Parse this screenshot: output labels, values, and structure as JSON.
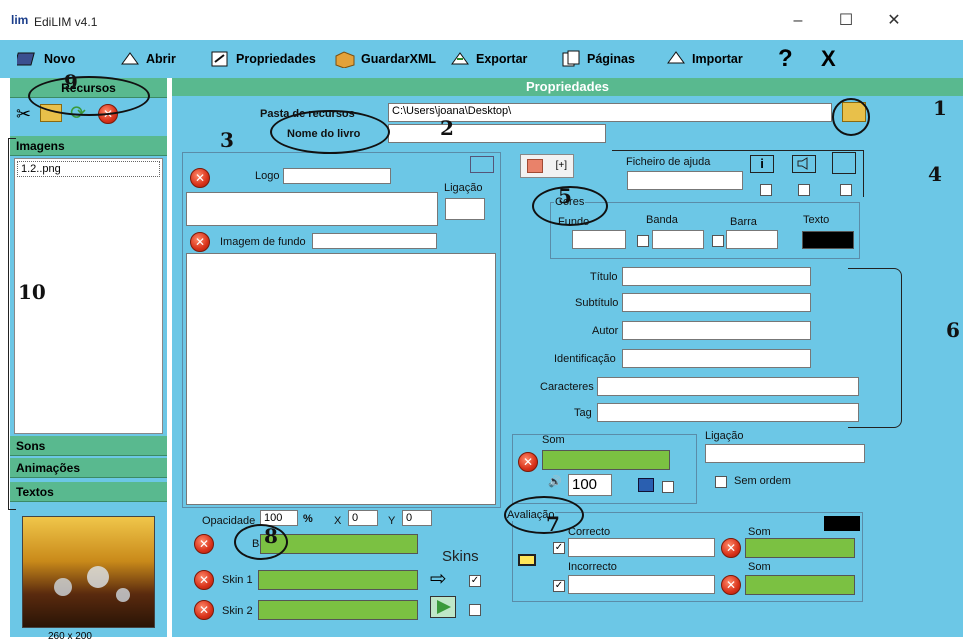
{
  "window": {
    "app_name": "EdiLIM v4.1",
    "logo_text": "lim",
    "minimize": "–",
    "maximize": "☐",
    "close": "✕"
  },
  "menu": {
    "novo": "Novo",
    "abrir": "Abrir",
    "propriedades": "Propriedades",
    "guardar": "GuardarXML",
    "exportar": "Exportar",
    "paginas": "Páginas",
    "importar": "Importar",
    "help": "?",
    "exit": "X"
  },
  "sidebar": {
    "title": "Recursos",
    "imagens": "Imagens",
    "files": [
      "1.2..png"
    ],
    "sons": "Sons",
    "animacoes": "Animações",
    "textos": "Textos",
    "preview_size": "260 x 200"
  },
  "main": {
    "header": "Propriedades",
    "pasta_label": "Pasta de recursos",
    "pasta_value": "C:\\Users\\joana\\Desktop\\",
    "nome_label": "Nome do livro",
    "nome_value": "",
    "logo_label": "Logo",
    "ligacao_label": "Ligação",
    "imagem_fundo_label": "Imagem de fundo",
    "opacidade_label": "Opacidade",
    "opacidade_value": "100",
    "percent": "%",
    "x_label": "X",
    "x_value": "0",
    "y_label": "Y",
    "y_value": "0",
    "barra_label": "Barra",
    "skins_label": "Skins",
    "skin1_label": "Skin 1",
    "skin2_label": "Skin 2",
    "plus_button": "[+]",
    "ficheiro_ajuda_label": "Ficheiro de ajuda",
    "cores_label": "Cores",
    "fundo_label": "Fundo",
    "banda_label": "Banda",
    "barra2_label": "Barra",
    "texto_label": "Texto",
    "titulo_label": "Título",
    "subtitulo_label": "Subtítulo",
    "autor_label": "Autor",
    "identificacao_label": "Identificação",
    "caracteres_label": "Caracteres",
    "tag_label": "Tag",
    "som_label": "Som",
    "volume_value": "100",
    "ligacao2_label": "Ligação",
    "sem_ordem_label": "Sem ordem",
    "avaliacao_label": "Avaliação",
    "correcto_label": "Correcto",
    "incorrecto_label": "Incorrecto",
    "som_correcto_label": "Som",
    "som_incorrecto_label": "Som"
  },
  "annotations": [
    "1",
    "2",
    "3",
    "4",
    "5",
    "6",
    "7",
    "8",
    "9",
    "10"
  ],
  "colors": {
    "accent": "#6cc7e6",
    "header_green": "#59b98f",
    "slot_green": "#7bc142",
    "texto_color": "#000000"
  }
}
